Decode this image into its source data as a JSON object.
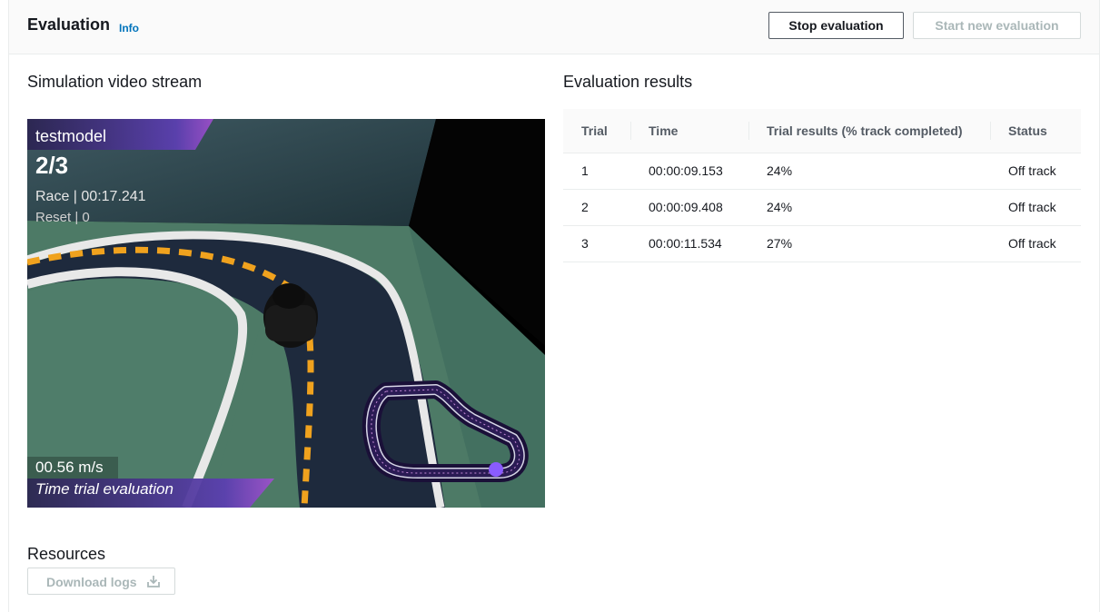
{
  "header": {
    "title": "Evaluation",
    "info_link": "Info",
    "stop_button": "Stop evaluation",
    "start_button": "Start new evaluation"
  },
  "simulation": {
    "title": "Simulation video stream",
    "overlay": {
      "model_name": "testmodel",
      "lap": "2/3",
      "race_time": "Race | 00:17.241",
      "reset": "Reset | 0",
      "speed": "00.56 m/s",
      "mode": "Time trial evaluation"
    }
  },
  "results": {
    "title": "Evaluation results",
    "columns": [
      "Trial",
      "Time",
      "Trial results (% track completed)",
      "Status"
    ],
    "rows": [
      [
        "1",
        "00:00:09.153",
        "24%",
        "Off track"
      ],
      [
        "2",
        "00:00:09.408",
        "24%",
        "Off track"
      ],
      [
        "3",
        "00:00:11.534",
        "27%",
        "Off track"
      ]
    ]
  },
  "resources": {
    "title": "Resources",
    "download_button": "Download logs"
  },
  "icons": {
    "download": "download-icon"
  }
}
